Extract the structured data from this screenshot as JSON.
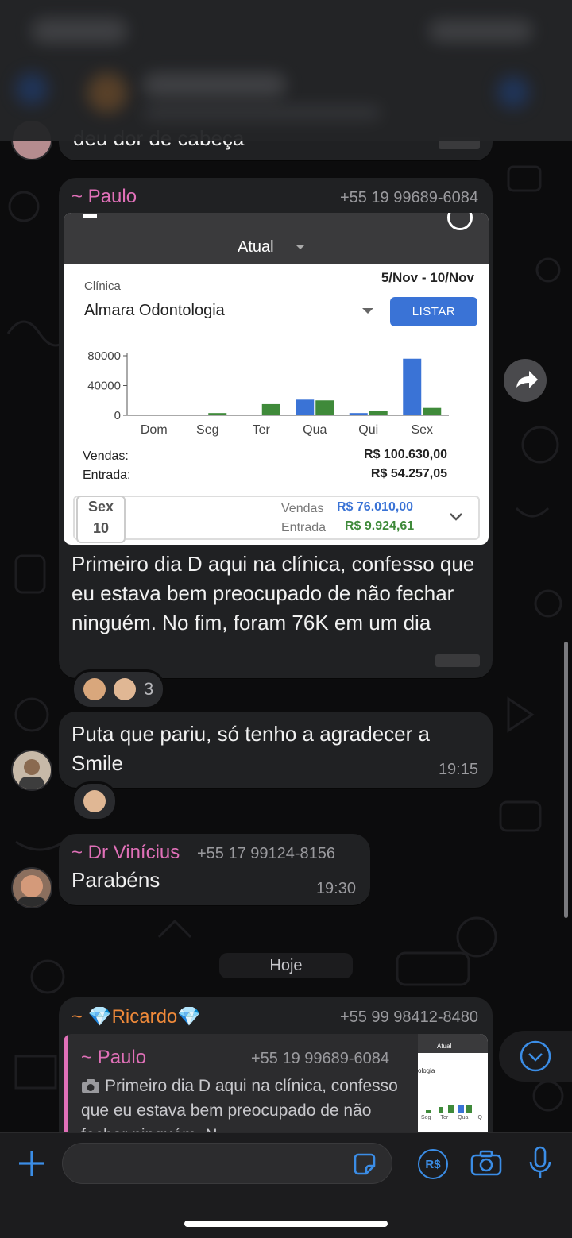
{
  "partial_top_text": "deu dor de cabeça",
  "messages": {
    "paulo": {
      "sender": "~ Paulo",
      "phone": "+55 19 99689-6084",
      "text": "Primeiro dia D aqui na clínica, confesso que eu estava bem preocupado de não fechar ninguém. No fim, foram 76K em um dia",
      "reactions_count": "3"
    },
    "reply1": {
      "text": "Puta que pariu, só tenho a agradecer a Smile",
      "time": "19:15"
    },
    "vinicius": {
      "sender": "~ Dr Vinícius",
      "phone": "+55 17 99124-8156",
      "text": "Parabéns",
      "time": "19:30"
    },
    "date_separator": "Hoje",
    "ricardo": {
      "sender": "~ 💎Ricardo💎",
      "phone": "+55 99 98412-8480",
      "quote": {
        "sender": "~ Paulo",
        "phone": "+55 19 99689-6084",
        "text": "Primeiro dia D aqui na clínica, confesso que eu estava bem preocupado de não fechar ninguém. N",
        "thumb_labels": {
          "atual": "Atual",
          "clinic_fragment": "ologia",
          "days": [
            "Seg",
            "Ter",
            "Qua",
            "Q"
          ]
        }
      }
    }
  },
  "app_screenshot": {
    "period_selector": "Atual",
    "clinic_label": "Clínica",
    "date_range": "5/Nov - 10/Nov",
    "clinic_value": "Almara Odontologia",
    "list_button": "LISTAR",
    "vendas_label": "Vendas:",
    "vendas_value": "R$ 100.630,00",
    "entrada_label": "Entrada:",
    "entrada_value": "R$ 54.257,05",
    "day_card": {
      "day": "Sex",
      "date": "10",
      "vendas_label": "Vendas",
      "vendas_value": "R$ 76.010,00",
      "entrada_label": "Entrada",
      "entrada_value": "R$ 9.924,61"
    },
    "colors": {
      "vendas": "#3a73d6",
      "entrada": "#3f8a3a",
      "button": "#3a73d6"
    }
  },
  "chart_data": {
    "type": "bar",
    "categories": [
      "Dom",
      "Seg",
      "Ter",
      "Qua",
      "Qui",
      "Sex"
    ],
    "series": [
      {
        "values": [
          0,
          0,
          1000,
          21000,
          3000,
          76010
        ]
      },
      {
        "values": [
          0,
          3000,
          15000,
          20000,
          6000,
          9925
        ]
      }
    ],
    "yticks": [
      "80000",
      "40000",
      "0"
    ],
    "ylim": [
      0,
      80000
    ]
  },
  "composer": {
    "icons": [
      "plus-icon",
      "sticker-icon",
      "pix-icon",
      "camera-icon",
      "microphone-icon"
    ],
    "pix_symbol": "R$"
  }
}
